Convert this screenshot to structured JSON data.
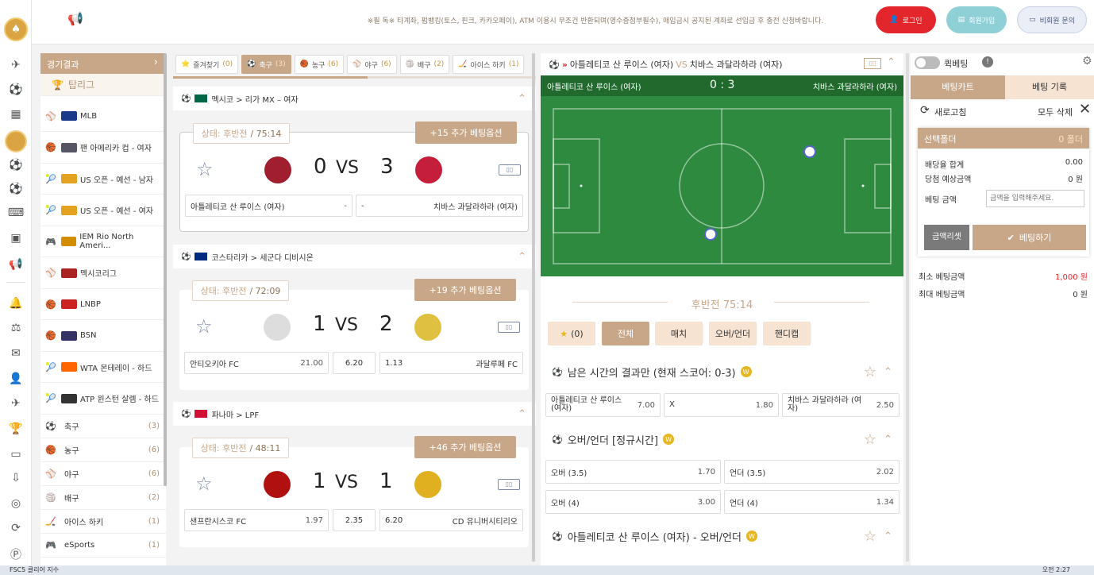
{
  "topbar": {
    "notice": "※필 독※ 타계좌, 펌뱅킹(토스, 핀크, 카카오페이), ATM 이용시 무조건 반환되며(영수증첨부필수), 매입금시 공지된 계좌로 선입금 후 충전 신청바랍니다.",
    "login": "로그인",
    "signup": "회원가입",
    "guest": "비회원 문의"
  },
  "leftnav": {
    "header": "경기결과",
    "top_league": "탑리그",
    "leagues": [
      {
        "name": "MLB",
        "count": ""
      },
      {
        "name": "팬 아메리카 컵 - 여자",
        "count": ""
      },
      {
        "name": "US 오픈 - 예선 - 남자",
        "count": ""
      },
      {
        "name": "US 오픈 - 예선 - 여자",
        "count": ""
      },
      {
        "name": "IEM Rio North Ameri...",
        "count": ""
      },
      {
        "name": "멕시코리그",
        "count": ""
      },
      {
        "name": "LNBP",
        "count": ""
      },
      {
        "name": "BSN",
        "count": ""
      },
      {
        "name": "WTA 몬테레이 - 하드",
        "count": ""
      },
      {
        "name": "ATP 윈스턴 살렘 - 하드",
        "count": ""
      }
    ],
    "sports": [
      {
        "name": "축구",
        "count": "(3)"
      },
      {
        "name": "농구",
        "count": "(6)"
      },
      {
        "name": "야구",
        "count": "(6)"
      },
      {
        "name": "배구",
        "count": "(2)"
      },
      {
        "name": "아이스 하키",
        "count": "(1)"
      },
      {
        "name": "eSports",
        "count": "(1)"
      }
    ]
  },
  "tabs": [
    {
      "label": "즐겨찾기",
      "count": "(0)"
    },
    {
      "label": "축구",
      "count": "(3)"
    },
    {
      "label": "농구",
      "count": "(6)"
    },
    {
      "label": "야구",
      "count": "(6)"
    },
    {
      "label": "배구",
      "count": "(2)"
    },
    {
      "label": "아이스 하키",
      "count": "(1)"
    }
  ],
  "matches": [
    {
      "league": "멕시코 > 리가 MX – 여자",
      "status": "상태: 후반전",
      "time": "/ 75:14",
      "more": "+15 추가 베팅옵션",
      "home_score": "0",
      "away_score": "3",
      "vs": "VS",
      "home": "아틀레티코 산 루이스 (여자)",
      "home_odds": "-",
      "draw": "",
      "away": "치바스 과달라하라 (여자)",
      "away_odds": "-"
    },
    {
      "league": "코스타리카 > 세군다 디비시온",
      "status": "상태: 후반전",
      "time": "/ 72:09",
      "more": "+19 추가 베팅옵션",
      "home_score": "1",
      "away_score": "2",
      "vs": "VS",
      "home": "안티오키아 FC",
      "home_odds": "21.00",
      "draw": "6.20",
      "away": "과달루페 FC",
      "away_odds": "1.13"
    },
    {
      "league": "파나마 > LPF",
      "status": "상태: 후반전",
      "time": "/ 48:11",
      "more": "+46 추가 베팅옵션",
      "home_score": "1",
      "away_score": "1",
      "vs": "VS",
      "home": "샌프란시스코 FC",
      "home_odds": "1.97",
      "draw": "2.35",
      "away": "CD 유니버시티리오",
      "away_odds": "6.20"
    }
  ],
  "detail": {
    "home": "아틀레티코 산 루이스 (여자)",
    "vs": "VS",
    "away": "치바스 과달라하라 (여자)",
    "score": "0 : 3",
    "period": "후반전  75:14",
    "filters": [
      "(0)",
      "전체",
      "매치",
      "오버/언더",
      "핸디캡"
    ],
    "markets": [
      {
        "title": "남은 시간의 결과만 (현재 스코어: 0-3)"
      },
      {
        "title": "오버/언더 [정규시간]"
      },
      {
        "title": "아틀레티코 산 루이스 (여자) - 오버/언더"
      }
    ],
    "m1": [
      {
        "label": "아틀레티코 산 루이스 (여자)",
        "odds": "7.00"
      },
      {
        "label": "X",
        "odds": "1.80"
      },
      {
        "label": "치바스 과달라하라 (여자)",
        "odds": "2.50"
      }
    ],
    "m2": [
      {
        "label": "오버 (3.5)",
        "odds": "1.70"
      },
      {
        "label": "언더 (3.5)",
        "odds": "2.02"
      },
      {
        "label": "오버 (4)",
        "odds": "3.00"
      },
      {
        "label": "언더 (4)",
        "odds": "1.34"
      }
    ]
  },
  "bet": {
    "quick": "퀵베팅",
    "tab_cart": "베팅카트",
    "tab_history": "베팅 기록",
    "refresh": "새로고침",
    "clear": "모두 삭제",
    "folder": "선택폴더",
    "folder_count": "0 폴더",
    "odds_sum_label": "배당율 합계",
    "odds_sum": "0.00",
    "win_label": "당첨 예상금액",
    "win": "0 원",
    "amount_label": "베팅 금액",
    "amount_placeholder": "금액을 입력해주세요.",
    "reset": "금액리셋",
    "place": "베팅하기",
    "min_label": "최소 베팅금액",
    "min": "1,000 원",
    "max_label": "최대 베팅금액",
    "max": "0 원"
  },
  "taskbar": {
    "left": "FSC5 클리어 지수",
    "right": "오전 2:27"
  },
  "colors": {
    "accent": "#c8a789",
    "login": "#e3262c",
    "signup": "#8fcfd6",
    "field": "#2d8a3f"
  }
}
